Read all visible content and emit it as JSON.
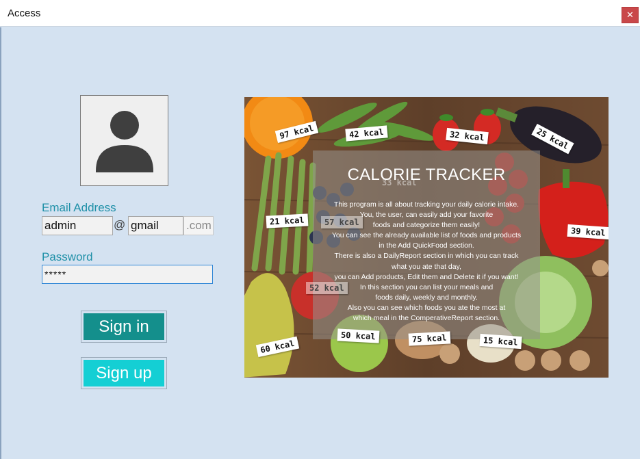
{
  "window": {
    "title": "Access",
    "close_glyph": "✕"
  },
  "form": {
    "email_label": "Email Address",
    "username_value": "admin",
    "at_symbol": "@",
    "domain_value": "gmail",
    "tld_placeholder": ".com",
    "password_label": "Password",
    "password_value": "*****",
    "signin_label": "Sign in",
    "signup_label": "Sign up"
  },
  "avatar": {
    "icon": "user-silhouette-icon"
  },
  "banner": {
    "title": "CALORIE TRACKER",
    "description_lines": [
      "This program is all about tracking your daily calorie intake.",
      "You, the user, can easily add your favorite",
      "foods and categorize them easily!",
      "You can see the already available list of foods and products",
      "in the Add QuickFood section.",
      "There is also a DailyReport section in which you can track",
      "what you ate that day,",
      "you can Add products, Edit them and Delete it if you want!",
      "In this section you can list your meals and",
      "foods daily, weekly and monthly.",
      "Also you can see which foods you ate the most at",
      "which meal in the ComperativeReport section."
    ],
    "kcal_tags": [
      {
        "text": "97 kcal",
        "name": "kcal-tag-orange"
      },
      {
        "text": "42 kcal",
        "name": "kcal-tag-peas"
      },
      {
        "text": "32 kcal",
        "name": "kcal-tag-strawberry"
      },
      {
        "text": "25 kcal",
        "name": "kcal-tag-eggplant"
      },
      {
        "text": "21 kcal",
        "name": "kcal-tag-asparagus"
      },
      {
        "text": "57 kcal",
        "name": "kcal-tag-blueberry"
      },
      {
        "text": "39 kcal",
        "name": "kcal-tag-pepper"
      },
      {
        "text": "52 kcal",
        "name": "kcal-tag-apple-red"
      },
      {
        "text": "50 kcal",
        "name": "kcal-tag-apple-green"
      },
      {
        "text": "75 kcal",
        "name": "kcal-tag-potato"
      },
      {
        "text": "15 kcal",
        "name": "kcal-tag-onion"
      },
      {
        "text": "60 kcal",
        "name": "kcal-tag-pear"
      },
      {
        "text": "33 kcal",
        "name": "kcal-tag-tomato"
      }
    ]
  }
}
